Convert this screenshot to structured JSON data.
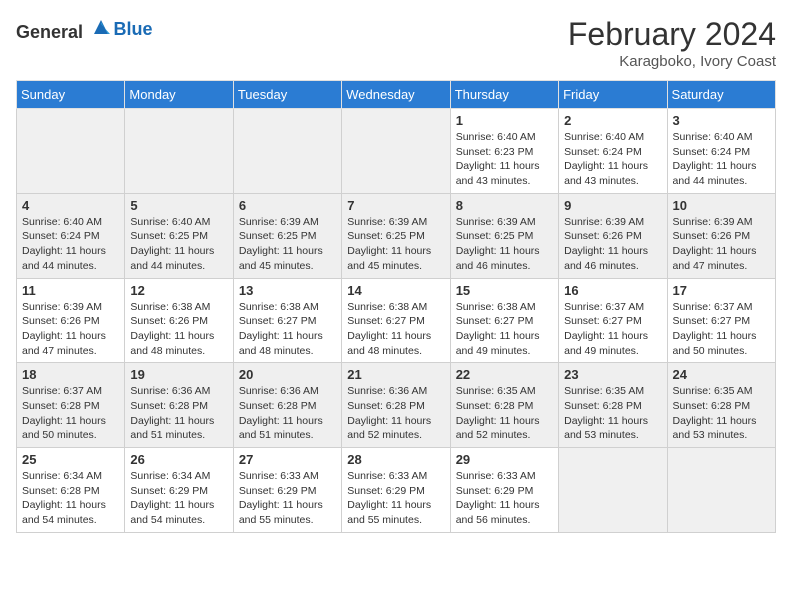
{
  "header": {
    "logo_general": "General",
    "logo_blue": "Blue",
    "month_year": "February 2024",
    "location": "Karagboko, Ivory Coast"
  },
  "days_of_week": [
    "Sunday",
    "Monday",
    "Tuesday",
    "Wednesday",
    "Thursday",
    "Friday",
    "Saturday"
  ],
  "weeks": [
    [
      {
        "day": "",
        "info": ""
      },
      {
        "day": "",
        "info": ""
      },
      {
        "day": "",
        "info": ""
      },
      {
        "day": "",
        "info": ""
      },
      {
        "day": "1",
        "info": "Sunrise: 6:40 AM\nSunset: 6:23 PM\nDaylight: 11 hours and 43 minutes."
      },
      {
        "day": "2",
        "info": "Sunrise: 6:40 AM\nSunset: 6:24 PM\nDaylight: 11 hours and 43 minutes."
      },
      {
        "day": "3",
        "info": "Sunrise: 6:40 AM\nSunset: 6:24 PM\nDaylight: 11 hours and 44 minutes."
      }
    ],
    [
      {
        "day": "4",
        "info": "Sunrise: 6:40 AM\nSunset: 6:24 PM\nDaylight: 11 hours and 44 minutes."
      },
      {
        "day": "5",
        "info": "Sunrise: 6:40 AM\nSunset: 6:25 PM\nDaylight: 11 hours and 44 minutes."
      },
      {
        "day": "6",
        "info": "Sunrise: 6:39 AM\nSunset: 6:25 PM\nDaylight: 11 hours and 45 minutes."
      },
      {
        "day": "7",
        "info": "Sunrise: 6:39 AM\nSunset: 6:25 PM\nDaylight: 11 hours and 45 minutes."
      },
      {
        "day": "8",
        "info": "Sunrise: 6:39 AM\nSunset: 6:25 PM\nDaylight: 11 hours and 46 minutes."
      },
      {
        "day": "9",
        "info": "Sunrise: 6:39 AM\nSunset: 6:26 PM\nDaylight: 11 hours and 46 minutes."
      },
      {
        "day": "10",
        "info": "Sunrise: 6:39 AM\nSunset: 6:26 PM\nDaylight: 11 hours and 47 minutes."
      }
    ],
    [
      {
        "day": "11",
        "info": "Sunrise: 6:39 AM\nSunset: 6:26 PM\nDaylight: 11 hours and 47 minutes."
      },
      {
        "day": "12",
        "info": "Sunrise: 6:38 AM\nSunset: 6:26 PM\nDaylight: 11 hours and 48 minutes."
      },
      {
        "day": "13",
        "info": "Sunrise: 6:38 AM\nSunset: 6:27 PM\nDaylight: 11 hours and 48 minutes."
      },
      {
        "day": "14",
        "info": "Sunrise: 6:38 AM\nSunset: 6:27 PM\nDaylight: 11 hours and 48 minutes."
      },
      {
        "day": "15",
        "info": "Sunrise: 6:38 AM\nSunset: 6:27 PM\nDaylight: 11 hours and 49 minutes."
      },
      {
        "day": "16",
        "info": "Sunrise: 6:37 AM\nSunset: 6:27 PM\nDaylight: 11 hours and 49 minutes."
      },
      {
        "day": "17",
        "info": "Sunrise: 6:37 AM\nSunset: 6:27 PM\nDaylight: 11 hours and 50 minutes."
      }
    ],
    [
      {
        "day": "18",
        "info": "Sunrise: 6:37 AM\nSunset: 6:28 PM\nDaylight: 11 hours and 50 minutes."
      },
      {
        "day": "19",
        "info": "Sunrise: 6:36 AM\nSunset: 6:28 PM\nDaylight: 11 hours and 51 minutes."
      },
      {
        "day": "20",
        "info": "Sunrise: 6:36 AM\nSunset: 6:28 PM\nDaylight: 11 hours and 51 minutes."
      },
      {
        "day": "21",
        "info": "Sunrise: 6:36 AM\nSunset: 6:28 PM\nDaylight: 11 hours and 52 minutes."
      },
      {
        "day": "22",
        "info": "Sunrise: 6:35 AM\nSunset: 6:28 PM\nDaylight: 11 hours and 52 minutes."
      },
      {
        "day": "23",
        "info": "Sunrise: 6:35 AM\nSunset: 6:28 PM\nDaylight: 11 hours and 53 minutes."
      },
      {
        "day": "24",
        "info": "Sunrise: 6:35 AM\nSunset: 6:28 PM\nDaylight: 11 hours and 53 minutes."
      }
    ],
    [
      {
        "day": "25",
        "info": "Sunrise: 6:34 AM\nSunset: 6:28 PM\nDaylight: 11 hours and 54 minutes."
      },
      {
        "day": "26",
        "info": "Sunrise: 6:34 AM\nSunset: 6:29 PM\nDaylight: 11 hours and 54 minutes."
      },
      {
        "day": "27",
        "info": "Sunrise: 6:33 AM\nSunset: 6:29 PM\nDaylight: 11 hours and 55 minutes."
      },
      {
        "day": "28",
        "info": "Sunrise: 6:33 AM\nSunset: 6:29 PM\nDaylight: 11 hours and 55 minutes."
      },
      {
        "day": "29",
        "info": "Sunrise: 6:33 AM\nSunset: 6:29 PM\nDaylight: 11 hours and 56 minutes."
      },
      {
        "day": "",
        "info": ""
      },
      {
        "day": "",
        "info": ""
      }
    ]
  ]
}
